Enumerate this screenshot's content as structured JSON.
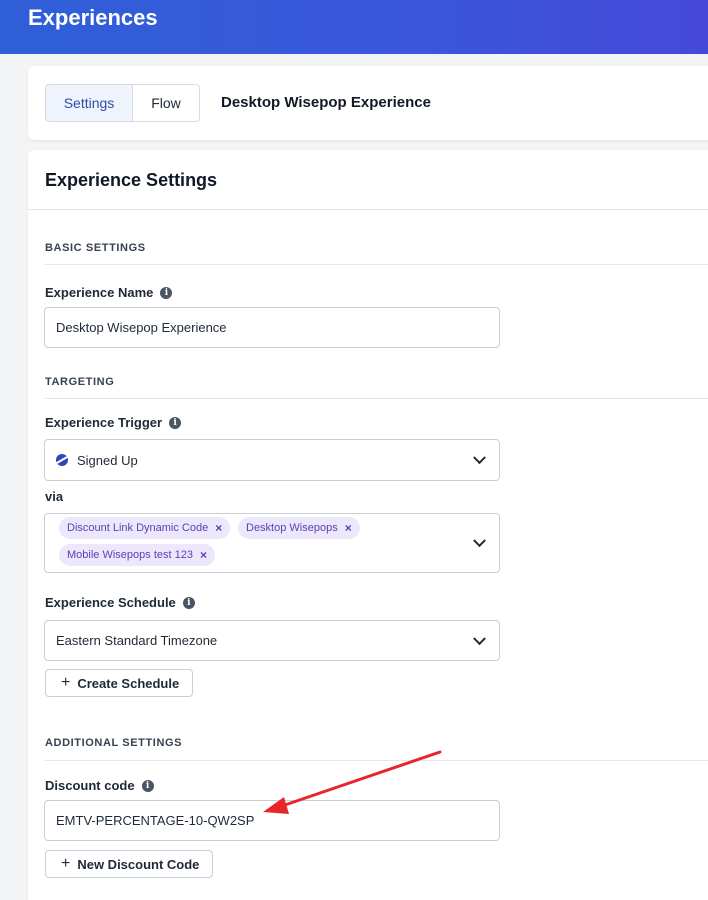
{
  "header": {
    "title": "Experiences"
  },
  "tabs": [
    {
      "label": "Settings"
    },
    {
      "label": "Flow"
    }
  ],
  "experience_title": "Desktop Wisepop Experience",
  "settings": {
    "heading": "Experience Settings",
    "basic_section": "BASIC SETTINGS",
    "name_label": "Experience Name",
    "name_value": "Desktop Wisepop Experience",
    "targeting_section": "TARGETING",
    "trigger_label": "Experience Trigger",
    "trigger_value": "Signed Up",
    "via_label": "via",
    "via_chips": [
      {
        "label": "Discount Link Dynamic Code",
        "remove": "×"
      },
      {
        "label": "Desktop Wisepops",
        "remove": "×"
      },
      {
        "label": "Mobile Wisepops test 123",
        "remove": "×"
      }
    ],
    "schedule_label": "Experience Schedule",
    "schedule_value": "Eastern Standard Timezone",
    "create_schedule_button": "Create Schedule",
    "additional_section": "ADDITIONAL SETTINGS",
    "discount_label": "Discount code",
    "discount_value": "EMTV-PERCENTAGE-10-QW2SP",
    "new_discount_button": "New Discount Code"
  },
  "colors": {
    "header_gradient_start": "#2f5fd8",
    "header_gradient_end": "#4648d9",
    "annotation_arrow": "#e8262a",
    "chip_bg": "#ede7fb",
    "chip_text": "#5b3fb8"
  }
}
